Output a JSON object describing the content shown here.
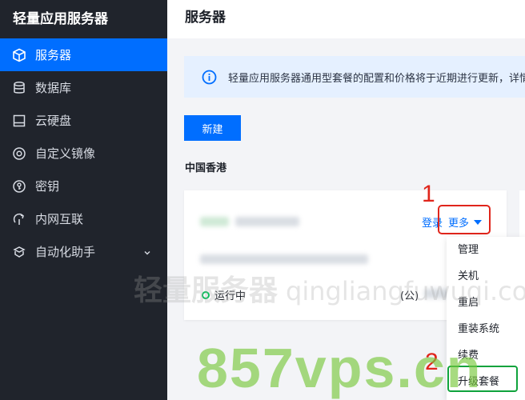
{
  "sidebar": {
    "brand": "轻量应用服务器",
    "items": [
      {
        "label": "服务器",
        "icon": "cube-icon"
      },
      {
        "label": "数据库",
        "icon": "database-icon"
      },
      {
        "label": "云硬盘",
        "icon": "disk-icon"
      },
      {
        "label": "自定义镜像",
        "icon": "image-icon"
      },
      {
        "label": "密钥",
        "icon": "key-icon"
      },
      {
        "label": "内网互联",
        "icon": "link-icon"
      },
      {
        "label": "自动化助手",
        "icon": "automation-icon"
      }
    ]
  },
  "header": {
    "title": "服务器"
  },
  "notice": {
    "text": "轻量应用服务器通用型套餐的配置和价格将于近期进行更新，详情"
  },
  "toolbar": {
    "new_label": "新建"
  },
  "region": "中国香港",
  "card": {
    "login_label": "登录",
    "more_label": "更多",
    "status": "运行中",
    "ip_prefix": "(公)"
  },
  "more_menu": [
    "管理",
    "关机",
    "重启",
    "重装系统",
    "续费",
    "升级套餐"
  ],
  "annotations": {
    "step1": "1",
    "step2": "2"
  },
  "watermarks": {
    "brand": "轻量服务器",
    "domain": "qingliangfuwuqi.com",
    "site": "857vps.cn"
  },
  "colors": {
    "accent": "#006eff",
    "sidebar_bg": "#20242c",
    "running": "#0abf5b",
    "highlight": "#e0251b"
  }
}
